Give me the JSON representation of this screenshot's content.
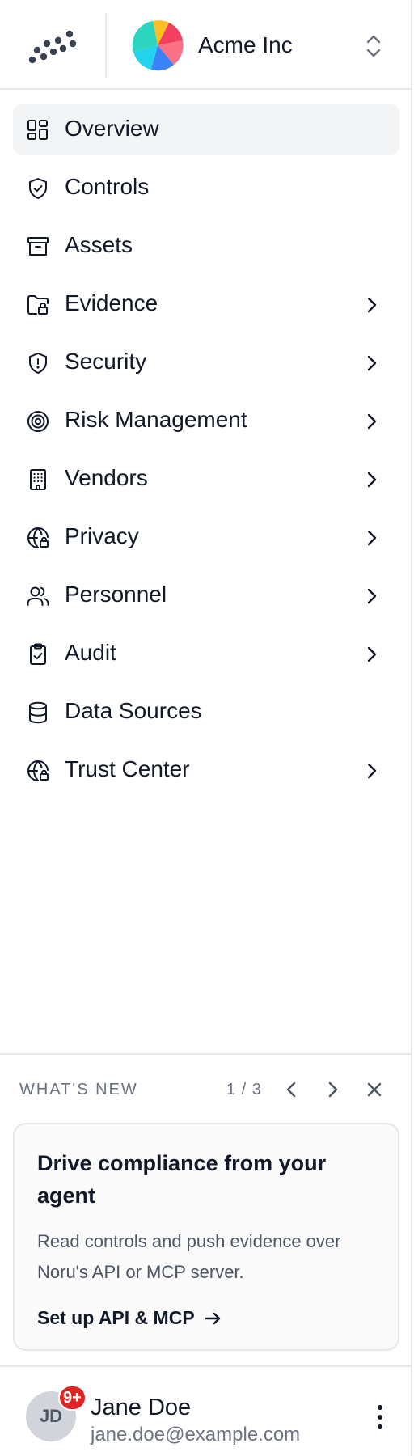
{
  "header": {
    "org_name": "Acme Inc",
    "logo_icon": "noru-dots-logo",
    "org_logo_icon": "pinwheel-logo",
    "switcher_icon": "chevron-up-down-icon"
  },
  "nav": {
    "items": [
      {
        "label": "Overview",
        "icon": "layout-grid-icon",
        "active": true,
        "has_children": false
      },
      {
        "label": "Controls",
        "icon": "shield-check-icon",
        "active": false,
        "has_children": false
      },
      {
        "label": "Assets",
        "icon": "archive-box-icon",
        "active": false,
        "has_children": false
      },
      {
        "label": "Evidence",
        "icon": "folder-lock-icon",
        "active": false,
        "has_children": true
      },
      {
        "label": "Security",
        "icon": "shield-alert-icon",
        "active": false,
        "has_children": true
      },
      {
        "label": "Risk Management",
        "icon": "target-icon",
        "active": false,
        "has_children": true
      },
      {
        "label": "Vendors",
        "icon": "building-icon",
        "active": false,
        "has_children": true
      },
      {
        "label": "Privacy",
        "icon": "globe-lock-icon",
        "active": false,
        "has_children": true
      },
      {
        "label": "Personnel",
        "icon": "users-icon",
        "active": false,
        "has_children": true
      },
      {
        "label": "Audit",
        "icon": "clipboard-check-icon",
        "active": false,
        "has_children": true
      },
      {
        "label": "Data Sources",
        "icon": "database-icon",
        "active": false,
        "has_children": false
      },
      {
        "label": "Trust Center",
        "icon": "globe-lock-icon",
        "active": false,
        "has_children": true
      }
    ]
  },
  "whats_new": {
    "title": "WHAT'S NEW",
    "page": "1 / 3",
    "card": {
      "heading": "Drive compliance from your agent",
      "body": "Read controls and push evidence over Noru's API or MCP server.",
      "link": "Set up API & MCP"
    }
  },
  "user": {
    "initials": "JD",
    "badge": "9+",
    "name": "Jane Doe",
    "email": "jane.doe@example.com"
  },
  "colors": {
    "active_bg": "#f3f4f6",
    "badge": "#dc2626",
    "border": "#e5e7eb",
    "muted_text": "#6b7280"
  }
}
